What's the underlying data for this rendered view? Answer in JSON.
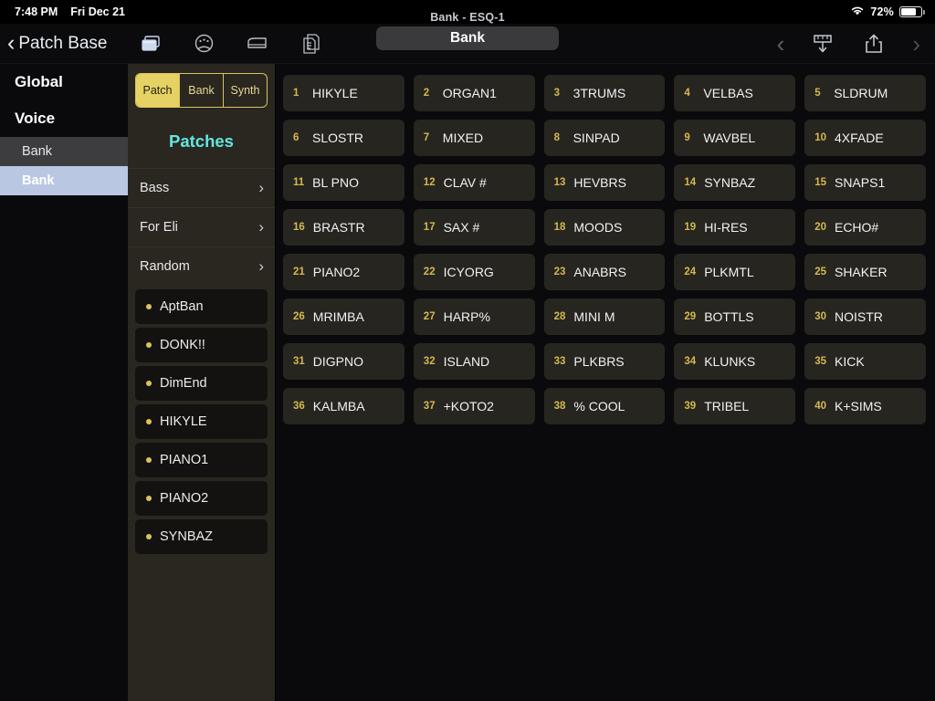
{
  "statusbar": {
    "time": "7:48 PM",
    "date": "Fri Dec 21",
    "wifi_icon": "wifi-icon",
    "battery_percent": "72%",
    "battery_icon": "battery-icon"
  },
  "navbar": {
    "back_label": "Patch Base",
    "back_chevron": "‹",
    "icons": [
      {
        "name": "windows-icon"
      },
      {
        "name": "knob-dial-icon"
      },
      {
        "name": "piano-keyboard-icon"
      },
      {
        "name": "documents-copy-icon"
      }
    ],
    "subtitle": "Bank - ESQ-1",
    "segment_label": "Bank",
    "prev_chevron": "‹",
    "next_chevron": "›",
    "download_icon": "download-to-synth-icon",
    "share_icon": "share-icon"
  },
  "sidebar": {
    "items": [
      {
        "label": "Global",
        "style": "head"
      },
      {
        "label": "Voice",
        "style": "head"
      },
      {
        "label": "Bank",
        "style": "sub"
      },
      {
        "label": "Bank",
        "style": "selected"
      }
    ]
  },
  "patchpanel": {
    "segments": [
      {
        "label": "Patch",
        "active": true
      },
      {
        "label": "Bank",
        "active": false
      },
      {
        "label": "Synth",
        "active": false
      }
    ],
    "title": "Patches",
    "folders": [
      {
        "label": "Bass",
        "chevron": "›"
      },
      {
        "label": "For Eli",
        "chevron": "›"
      },
      {
        "label": "Random",
        "chevron": "›"
      }
    ],
    "patches": [
      {
        "label": "AptBan"
      },
      {
        "label": "DONK!!"
      },
      {
        "label": "DimEnd"
      },
      {
        "label": "HIKYLE"
      },
      {
        "label": "PIANO1"
      },
      {
        "label": "PIANO2"
      },
      {
        "label": "SYNBAZ"
      }
    ]
  },
  "grid": {
    "cells": [
      {
        "num": "1",
        "name": "HIKYLE"
      },
      {
        "num": "2",
        "name": "ORGAN1"
      },
      {
        "num": "3",
        "name": "3TRUMS"
      },
      {
        "num": "4",
        "name": "VELBAS"
      },
      {
        "num": "5",
        "name": "SLDRUM"
      },
      {
        "num": "6",
        "name": "SLOSTR"
      },
      {
        "num": "7",
        "name": "MIXED"
      },
      {
        "num": "8",
        "name": "SINPAD"
      },
      {
        "num": "9",
        "name": "WAVBEL"
      },
      {
        "num": "10",
        "name": "4XFADE"
      },
      {
        "num": "11",
        "name": "BL PNO"
      },
      {
        "num": "12",
        "name": "CLAV #"
      },
      {
        "num": "13",
        "name": "HEVBRS"
      },
      {
        "num": "14",
        "name": "SYNBAZ"
      },
      {
        "num": "15",
        "name": "SNAPS1"
      },
      {
        "num": "16",
        "name": "BRASTR"
      },
      {
        "num": "17",
        "name": "SAX #"
      },
      {
        "num": "18",
        "name": "MOODS"
      },
      {
        "num": "19",
        "name": "HI-RES"
      },
      {
        "num": "20",
        "name": "ECHO#"
      },
      {
        "num": "21",
        "name": "PIANO2"
      },
      {
        "num": "22",
        "name": "ICYORG"
      },
      {
        "num": "23",
        "name": "ANABRS"
      },
      {
        "num": "24",
        "name": "PLKMTL"
      },
      {
        "num": "25",
        "name": "SHAKER"
      },
      {
        "num": "26",
        "name": "MRIMBA"
      },
      {
        "num": "27",
        "name": "HARP%"
      },
      {
        "num": "28",
        "name": "MINI M"
      },
      {
        "num": "29",
        "name": "BOTTLS"
      },
      {
        "num": "30",
        "name": "NOISTR"
      },
      {
        "num": "31",
        "name": "DIGPNO"
      },
      {
        "num": "32",
        "name": "ISLAND"
      },
      {
        "num": "33",
        "name": "PLKBRS"
      },
      {
        "num": "34",
        "name": "KLUNKS"
      },
      {
        "num": "35",
        "name": "KICK"
      },
      {
        "num": "36",
        "name": "KALMBA"
      },
      {
        "num": "37",
        "name": "+KOTO2"
      },
      {
        "num": "38",
        "name": "% COOL"
      },
      {
        "num": "39",
        "name": "TRIBEL"
      },
      {
        "num": "40",
        "name": "K+SIMS"
      }
    ]
  },
  "colors": {
    "accent_yellow": "#d4b94f",
    "segment_yellow": "#e6d264",
    "title_cyan": "#63e6e0",
    "selected_row_blue": "#b9c7e2",
    "panel_brown": "#2a2620",
    "cell_bg": "#262520"
  }
}
